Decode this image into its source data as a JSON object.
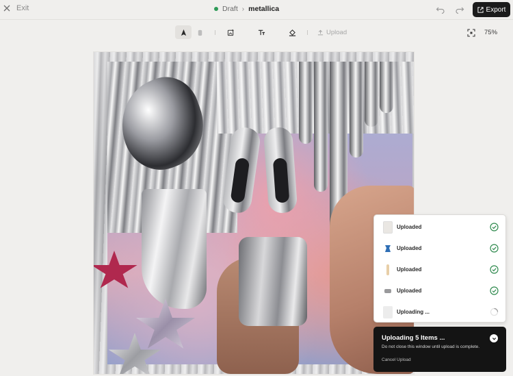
{
  "topbar": {
    "exit_label": "Exit",
    "status": "Draft",
    "document_name": "metallica",
    "export_label": "Export"
  },
  "toolbar": {
    "upload_label": "Upload",
    "zoom": "75%"
  },
  "uploads": {
    "items": [
      {
        "label": "Uploaded",
        "state": "done",
        "thumb_color": "#eae7e3"
      },
      {
        "label": "Uploaded",
        "state": "done",
        "thumb_color": "#2f6fb5"
      },
      {
        "label": "Uploaded",
        "state": "done",
        "thumb_color": "#e8cfa8"
      },
      {
        "label": "Uploaded",
        "state": "done",
        "thumb_color": "#9a9a9c"
      },
      {
        "label": "Uploading ...",
        "state": "progress",
        "thumb_color": "#ececec"
      }
    ]
  },
  "toast": {
    "title": "Uploading 5 Items ...",
    "subtitle": "Do not close this window until upload is complete.",
    "cancel_label": "Cancel Upload"
  },
  "colors": {
    "accent_dark": "#1b1b1b",
    "status_green": "#2e9a57",
    "check_green": "#2f8a4e"
  }
}
